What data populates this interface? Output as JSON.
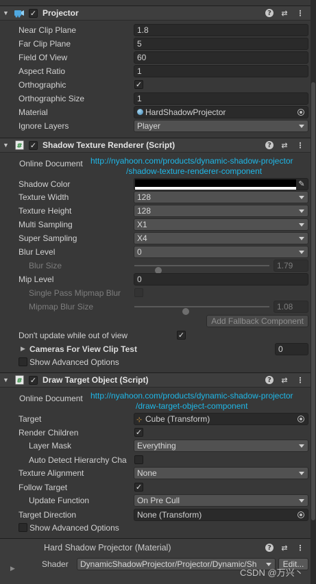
{
  "projector": {
    "title": "Projector",
    "rows": {
      "near_clip": {
        "label": "Near Clip Plane",
        "value": "1.8"
      },
      "far_clip": {
        "label": "Far Clip Plane",
        "value": "5"
      },
      "fov": {
        "label": "Field Of View",
        "value": "60"
      },
      "aspect": {
        "label": "Aspect Ratio",
        "value": "1"
      },
      "ortho": {
        "label": "Orthographic",
        "checked": "✓"
      },
      "ortho_size": {
        "label": "Orthographic Size",
        "value": "1"
      },
      "material": {
        "label": "Material",
        "value": "HardShadowProjector"
      },
      "ignore_layers": {
        "label": "Ignore Layers",
        "value": "Player"
      }
    }
  },
  "shadow_renderer": {
    "title": "Shadow Texture Renderer (Script)",
    "online_doc_label": "Online Document",
    "online_doc_link_1": "http://nyahoon.com/products/dynamic-shadow-projector",
    "online_doc_link_2": "/shadow-texture-renderer-component",
    "rows": {
      "shadow_color": {
        "label": "Shadow Color",
        "color": "#000000"
      },
      "tex_width": {
        "label": "Texture Width",
        "value": "128"
      },
      "tex_height": {
        "label": "Texture Height",
        "value": "128"
      },
      "multi_sampling": {
        "label": "Multi Sampling",
        "value": "X1"
      },
      "super_sampling": {
        "label": "Super Sampling",
        "value": "X4"
      },
      "blur_level": {
        "label": "Blur Level",
        "value": "0"
      },
      "blur_size": {
        "label": "Blur Size",
        "value": "1.79",
        "fraction": 0.18
      },
      "mip_level": {
        "label": "Mip Level",
        "value": "0"
      },
      "single_pass": {
        "label": "Single Pass Mipmap Blur"
      },
      "mipmap_blur": {
        "label": "Mipmap Blur Size",
        "value": "1.08",
        "fraction": 0.38
      },
      "add_fallback": {
        "label": "Add Fallback Component"
      },
      "dont_update": {
        "label": "Don't update while out of view",
        "checked": "✓"
      },
      "cameras_clip": {
        "label": "Cameras For View Clip Test",
        "value": "0"
      },
      "show_adv": {
        "label": "Show Advanced Options"
      }
    }
  },
  "draw_target": {
    "title": "Draw Target Object (Script)",
    "online_doc_label": "Online Document",
    "online_doc_link_1": "http://nyahoon.com/products/dynamic-shadow-projector",
    "online_doc_link_2": "/draw-target-object-component",
    "rows": {
      "target": {
        "label": "Target",
        "value": "Cube (Transform)"
      },
      "render_children": {
        "label": "Render Children",
        "checked": "✓"
      },
      "layer_mask": {
        "label": "Layer Mask",
        "value": "Everything"
      },
      "auto_detect": {
        "label": "Auto Detect Hierarchy Cha"
      },
      "tex_align": {
        "label": "Texture Alignment",
        "value": "None"
      },
      "follow_target": {
        "label": "Follow Target",
        "checked": "✓"
      },
      "update_func": {
        "label": "Update Function",
        "value": "On Pre Cull"
      },
      "target_dir": {
        "label": "Target Direction",
        "value": "None (Transform)"
      },
      "show_adv": {
        "label": "Show Advanced Options"
      }
    }
  },
  "material_section": {
    "title": "Hard Shadow Projector (Material)",
    "shader_label": "Shader",
    "shader_value": "DynamicShadowProjector/Projector/Dynamic/Sh",
    "edit_label": "Edit..."
  },
  "watermark": "CSDN @万兴丶",
  "icons": {
    "fold": "▼",
    "help": "?",
    "preset": "⇄",
    "menu": "⋮"
  },
  "colors": {
    "link": "#1fb8e8",
    "background": "#383838",
    "header": "#3e3e3e"
  }
}
